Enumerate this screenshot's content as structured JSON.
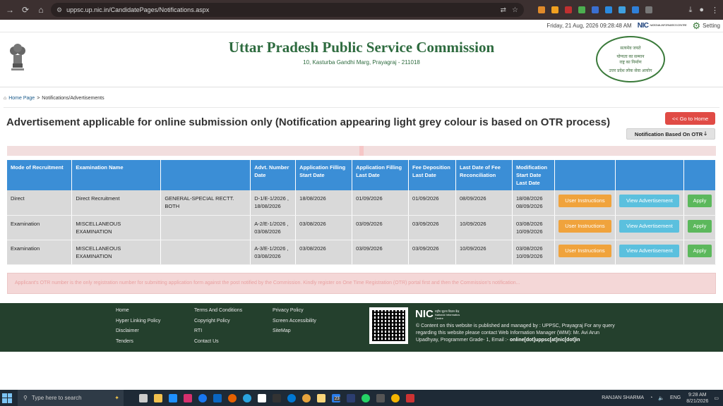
{
  "browser": {
    "url": "uppsc.up.nic.in/CandidatePages/Notifications.aspx"
  },
  "topstrip": {
    "datetime": "Friday, 21 Aug, 2026 09:28:48 AM",
    "nic_label": "NIC",
    "nic_sub": "NATIONAL INFORMATICS CENTRE",
    "settings_label": "Setting"
  },
  "header": {
    "title": "Uttar Pradesh Public Service Commission",
    "address": "10, Kasturba Gandhi Marg, Prayagraj - 211018",
    "seal_lines": [
      "सत्यमेव जयते",
      "योग्यता का सम्मान",
      "राष्ट्र का निर्माण",
      "उत्तर प्रदेश लोक सेवा आयोग"
    ]
  },
  "breadcrumb": {
    "home": "Home Page",
    "separator": ">",
    "current": "Notifications/Advertisements"
  },
  "page": {
    "heading": "Advertisement applicable for online submission only (Notification appearing light grey colour is based on OTR process)",
    "go_home": "<< Go to Home",
    "otr_button": "Notification Based On OTR"
  },
  "table": {
    "headers": [
      "Mode of Recruitment",
      "Examination Name",
      "",
      "Advt. Number Date",
      "Application Filling Start Date",
      "Application Filling Last Date",
      "Fee Deposition Last Date",
      "Last Date of Fee Reconciliation",
      "Modification Start Date Last Date",
      "",
      "",
      ""
    ],
    "rows": [
      {
        "mode": "Direct",
        "exam": "Direct Recruitment",
        "extra": "GENERAL-SPECIAL RECTT. BOTH",
        "advt": "D-1/E-1/2026 , 18/08/2026",
        "app_start": "18/08/2026",
        "app_last": "01/09/2026",
        "fee_last": "01/09/2026",
        "fee_recon": "08/09/2026",
        "mod_start": "18/08/2026",
        "mod_last": "08/09/2026",
        "btn_instructions": "User Instructions",
        "btn_view": "View Advertisement",
        "btn_apply": "Apply"
      },
      {
        "mode": "Examination",
        "exam": "MISCELLANEOUS EXAMINATION",
        "extra": "",
        "advt": "A-2/E-1/2026 , 03/08/2026",
        "app_start": "03/08/2026",
        "app_last": "03/09/2026",
        "fee_last": "03/09/2026",
        "fee_recon": "10/09/2026",
        "mod_start": "03/08/2026",
        "mod_last": "10/09/2026",
        "btn_instructions": "User Instructions",
        "btn_view": "View Advertisement",
        "btn_apply": "Apply"
      },
      {
        "mode": "Examination",
        "exam": "MISCELLANEOUS EXAMINATION",
        "extra": "",
        "advt": "A-3/E-1/2026 , 03/08/2026",
        "app_start": "03/08/2026",
        "app_last": "03/09/2026",
        "fee_last": "03/09/2026",
        "fee_recon": "10/09/2026",
        "mod_start": "03/08/2026",
        "mod_last": "10/09/2026",
        "btn_instructions": "User Instructions",
        "btn_view": "View Advertisement",
        "btn_apply": "Apply"
      }
    ]
  },
  "notice": "Applicant's OTR number is the only registration number for submitting application form against the post notified by the Commission. Kindly register on One Time Registration (OTR) portal first and then the Commission's notification...",
  "footer": {
    "col1": [
      "Home",
      "Hyper Linking Policy",
      "Disclaimer",
      "Tenders"
    ],
    "col2": [
      "Terms And Conditions",
      "Copyright Policy",
      "RTI",
      "Contact Us"
    ],
    "col3": [
      "Privacy Policy",
      "Screen Accessibility",
      "SiteMap"
    ],
    "nic_label": "NIC",
    "nic_sub": "राष्ट्रीय सूचना विज्ञान केंद्र National Informatics Centre",
    "info": "© Content on this website is published and managed by : UPPSC, Prayagraj For any query regarding this website please contact Web Information Manager (WIM): Mr. Avi Arun Upadhyay, Programmer Grade- 1, Email :-",
    "email": "online[dot]uppsc[at]nic[dot]in"
  },
  "taskbar": {
    "search_placeholder": "Type here to search",
    "badge": "23",
    "user": "RANJAN SHARMA",
    "lang": "ENG",
    "time": "9:28 AM",
    "date": "8/21/2026"
  }
}
